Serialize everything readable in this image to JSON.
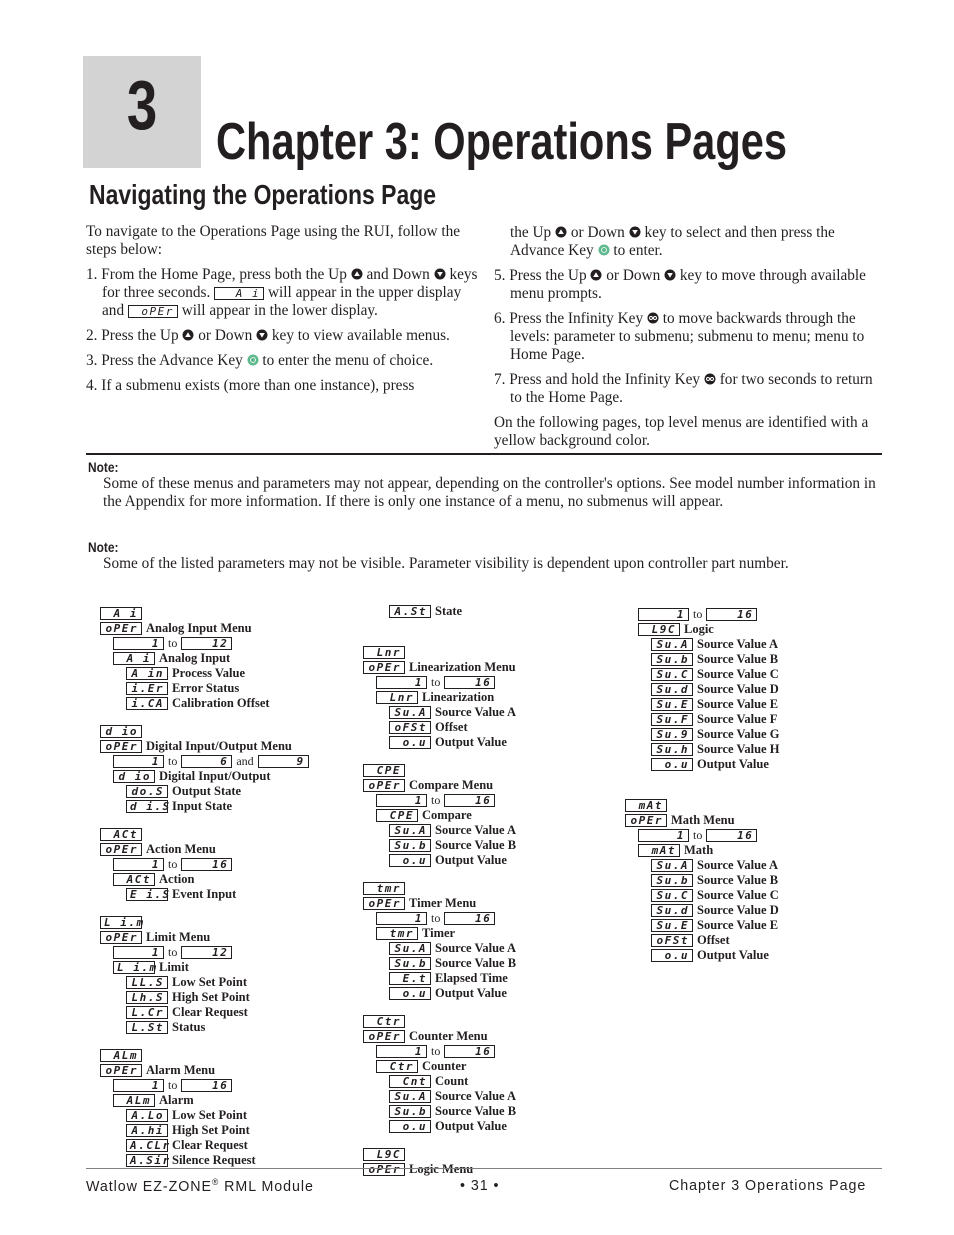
{
  "chapter": {
    "number": "3",
    "title": "Chapter 3: Operations Pages"
  },
  "section_title": "Navigating the Operations  Page",
  "intro": "To navigate to the Operations Page using the RUI, follow the steps below:",
  "steps": [
    {
      "num": "1.",
      "parts": [
        "From the Home Page, press both the Up ",
        "up-key",
        " and Down ",
        "down-key",
        " keys for three seconds. ",
        "lcd:A i",
        " will appear in the upper display and ",
        "lcd:oPEr",
        " will appear in the lower display."
      ]
    },
    {
      "num": "2.",
      "parts": [
        "Press the Up ",
        "up-key",
        " or Down ",
        "down-key",
        " key to view available menus."
      ]
    },
    {
      "num": "3.",
      "parts": [
        "Press the Advance Key ",
        "advance-key",
        " to enter the menu of choice."
      ]
    },
    {
      "num": "4.",
      "parts": [
        "If a submenu exists (more than one instance), press"
      ]
    }
  ],
  "step4_continued": [
    "the Up ",
    "up-key",
    " or Down ",
    "down-key",
    " key to select and then press the Advance Key ",
    "advance-key",
    " to enter."
  ],
  "steps_right": [
    {
      "num": "5.",
      "parts": [
        "Press the Up ",
        "up-key",
        " or Down ",
        "down-key",
        " key to move through available menu prompts."
      ]
    },
    {
      "num": "6.",
      "parts": [
        "Press the Infinity Key ",
        "infinity-key",
        " to move backwards through the levels: parameter to submenu; submenu to menu; menu to Home Page."
      ]
    },
    {
      "num": "7.",
      "parts": [
        "Press and hold the Infinity Key ",
        "infinity-key",
        " for two seconds to return to the Home Page."
      ]
    }
  ],
  "closing": "On the following pages, top level menus are identified with a yellow background color.",
  "notes": [
    {
      "label": "Note:",
      "text": "Some of these menus and parameters may not appear, depending on the controller's options. See model number information in the Appendix for more information. If there is only one instance of a menu, no submenus will appear."
    },
    {
      "label": "Note:",
      "text": "Some of the listed parameters may not be visible. Parameter visibility is dependent upon controller part number."
    }
  ],
  "menus_col1": [
    {
      "code": "A i",
      "menu": "Analog Input Menu",
      "range": [
        "1",
        "12"
      ],
      "sub_code": "A i",
      "sub": "Analog Input",
      "params": [
        [
          "A in",
          "Process Value"
        ],
        [
          "i.Er",
          "Error Status"
        ],
        [
          "i.CA",
          "Calibration Offset"
        ]
      ]
    },
    {
      "code": "d io",
      "menu": "Digital Input/Output Menu",
      "range": [
        "1",
        "6",
        "9"
      ],
      "range_joiner": "and",
      "sub_code": "d io",
      "sub": "Digital Input/Output",
      "params": [
        [
          "do.S",
          "Output State"
        ],
        [
          "d i.S",
          "Input State"
        ]
      ]
    },
    {
      "code": "ACt",
      "menu": "Action Menu",
      "range": [
        "1",
        "16"
      ],
      "sub_code": "ACt",
      "sub": "Action",
      "params": [
        [
          "E i.S",
          "Event Input"
        ]
      ]
    },
    {
      "code": "L i.m",
      "menu": "Limit Menu",
      "range": [
        "1",
        "12"
      ],
      "sub_code": "L i.m",
      "sub": "Limit",
      "params": [
        [
          "LL.S",
          "Low Set Point"
        ],
        [
          "Lh.S",
          "High Set Point"
        ],
        [
          "L.Cr",
          "Clear Request"
        ],
        [
          "L.St",
          "Status"
        ]
      ]
    },
    {
      "code": "ALm",
      "menu": "Alarm Menu",
      "range": [
        "1",
        "16"
      ],
      "sub_code": "ALm",
      "sub": "Alarm",
      "params": [
        [
          "A.Lo",
          "Low Set Point"
        ],
        [
          "A.hi",
          "High Set Point"
        ],
        [
          "A.CLr",
          "Clear Request"
        ],
        [
          "A.Sir",
          "Silence Request"
        ]
      ]
    }
  ],
  "menus_col2_top_param": [
    "A.St",
    "State"
  ],
  "menus_col2": [
    {
      "code": "Lnr",
      "menu": "Linearization Menu",
      "range": [
        "1",
        "16"
      ],
      "sub_code": "Lnr",
      "sub": "Linearization",
      "params": [
        [
          "Su.A",
          "Source Value A"
        ],
        [
          "oFSt",
          "Offset"
        ],
        [
          "o.u",
          "Output Value"
        ]
      ]
    },
    {
      "code": "CPE",
      "menu": "Compare Menu",
      "range": [
        "1",
        "16"
      ],
      "sub_code": "CPE",
      "sub": "Compare",
      "params": [
        [
          "Su.A",
          "Source Value A"
        ],
        [
          "Su.b",
          "Source Value B"
        ],
        [
          "o.u",
          "Output Value"
        ]
      ]
    },
    {
      "code": "tmr",
      "menu": "Timer Menu",
      "range": [
        "1",
        "16"
      ],
      "sub_code": "tmr",
      "sub": "Timer",
      "params": [
        [
          "Su.A",
          "Source Value A"
        ],
        [
          "Su.b",
          "Source Value B"
        ],
        [
          "E.t",
          "Elapsed Time"
        ],
        [
          "o.u",
          "Output Value"
        ]
      ]
    },
    {
      "code": "Ctr",
      "menu": "Counter Menu",
      "range": [
        "1",
        "16"
      ],
      "sub_code": "Ctr",
      "sub": "Counter",
      "params": [
        [
          "Cnt",
          "Count"
        ],
        [
          "Su.A",
          "Source Value A"
        ],
        [
          "Su.b",
          "Source Value B"
        ],
        [
          "o.u",
          "Output Value"
        ]
      ]
    },
    {
      "code": "L9C",
      "menu": "Logic Menu"
    }
  ],
  "menus_col3_logic": {
    "range": [
      "1",
      "16"
    ],
    "sub_code": "L9C",
    "sub": "Logic",
    "params": [
      [
        "Su.A",
        "Source Value A"
      ],
      [
        "Su.b",
        "Source Value B"
      ],
      [
        "Su.C",
        "Source Value C"
      ],
      [
        "Su.d",
        "Source Value D"
      ],
      [
        "Su.E",
        "Source Value E"
      ],
      [
        "Su.F",
        "Source Value F"
      ],
      [
        "Su.9",
        "Source Value G"
      ],
      [
        "Su.h",
        "Source Value H"
      ],
      [
        "o.u",
        "Output Value"
      ]
    ]
  },
  "menus_col3": [
    {
      "code": "mAt",
      "menu": "Math Menu",
      "range": [
        "1",
        "16"
      ],
      "sub_code": "mAt",
      "sub": "Math",
      "params": [
        [
          "Su.A",
          "Source Value A"
        ],
        [
          "Su.b",
          "Source Value B"
        ],
        [
          "Su.C",
          "Source Value C"
        ],
        [
          "Su.d",
          "Source Value D"
        ],
        [
          "Su.E",
          "Source Value E"
        ],
        [
          "oFSt",
          "Offset"
        ],
        [
          "o.u",
          "Output Value"
        ]
      ]
    }
  ],
  "oper_code": "oPEr",
  "range_to": "to",
  "footer": {
    "left": "Watlow EZ-ZONE",
    "reg": "®",
    "left_suffix": " RML Module",
    "center": "•  31  •",
    "right": "Chapter 3 Operations Page"
  },
  "colors": {
    "advance_key": "#5fb98e",
    "chapter_box": "#d3d3d3"
  }
}
